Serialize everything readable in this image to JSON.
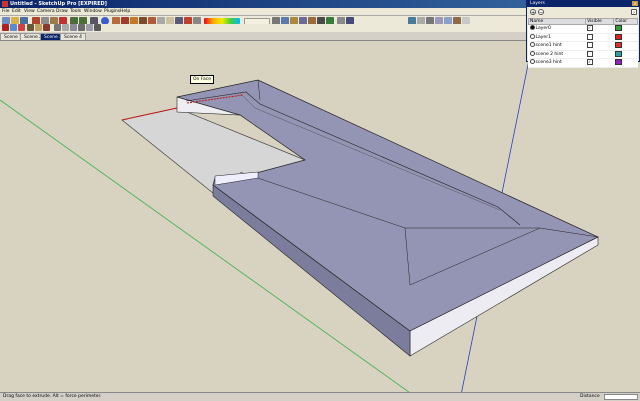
{
  "window": {
    "title": "Untitled - SketchUp Pro [EXPIRED]"
  },
  "menu": [
    "File",
    "Edit",
    "View",
    "Camera",
    "Draw",
    "Tools",
    "Window",
    "Plugins",
    "Help"
  ],
  "toolbar": {
    "current_layer": "Layer0"
  },
  "scene_tabs": [
    {
      "label": "Scene 1",
      "active": false
    },
    {
      "label": "Scene 2",
      "active": false
    },
    {
      "label": "Scene 3",
      "active": true
    },
    {
      "label": "Scene 4",
      "active": false
    }
  ],
  "viewport": {
    "tooltip": "On Face"
  },
  "layers_panel": {
    "title": "Layers",
    "columns": {
      "name": "Name",
      "visible": "Visible",
      "color": "Color"
    },
    "rows": [
      {
        "name": "Layer0",
        "current": true,
        "visible": true,
        "color": "#2e9e3a"
      },
      {
        "name": "Layer1",
        "current": false,
        "visible": false,
        "color": "#e02020"
      },
      {
        "name": "scene1 hint",
        "current": false,
        "visible": false,
        "color": "#e03030"
      },
      {
        "name": "scene 2 hint",
        "current": false,
        "visible": false,
        "color": "#2aa0a0"
      },
      {
        "name": "scene3 hint",
        "current": false,
        "visible": true,
        "color": "#9020c0"
      }
    ]
  },
  "status": {
    "hint": "Drag face to extrude. Alt = force perimeter.",
    "vcb_label": "Distance"
  }
}
